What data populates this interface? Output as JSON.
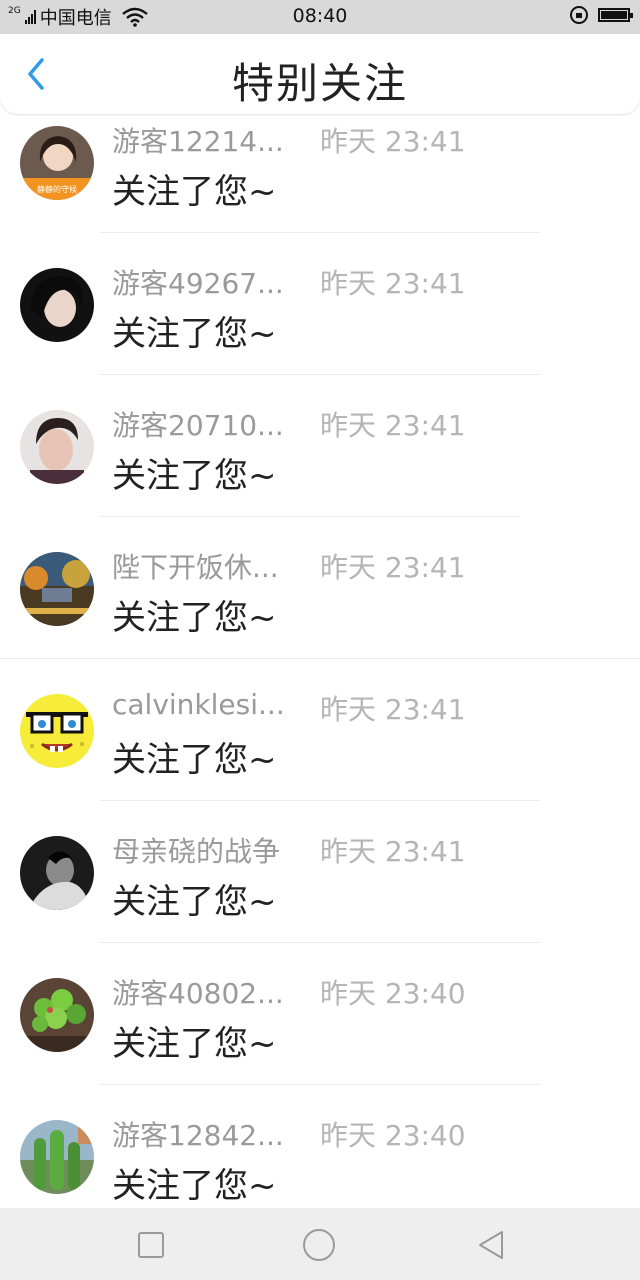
{
  "status_bar": {
    "network": "2G",
    "carrier": "中国电信",
    "time": "08:40"
  },
  "header": {
    "title": "特别关注",
    "back_icon": "chevron-left-icon",
    "accent_color": "#2f9be8"
  },
  "notifications": [
    {
      "name": "游客12214...",
      "time": "昨天 23:41",
      "message": "关注了您~",
      "avatar_label": "静静的守候"
    },
    {
      "name": "游客49267...",
      "time": "昨天 23:41",
      "message": "关注了您~"
    },
    {
      "name": "游客20710...",
      "time": "昨天 23:41",
      "message": "关注了您~"
    },
    {
      "name": "陛下开饭休...",
      "time": "昨天 23:41",
      "message": "关注了您~"
    },
    {
      "name": "calvinklesi...",
      "time": "昨天 23:41",
      "message": "关注了您~"
    },
    {
      "name": "母亲硗的战争",
      "time": "昨天 23:41",
      "message": "关注了您~"
    },
    {
      "name": "游客40802...",
      "time": "昨天 23:40",
      "message": "关注了您~"
    },
    {
      "name": "游客12842...",
      "time": "昨天 23:40",
      "message": "关注了您~"
    }
  ],
  "nav_bar": {
    "recent_icon": "square-icon",
    "home_icon": "circle-icon",
    "back_icon": "triangle-back-icon"
  }
}
